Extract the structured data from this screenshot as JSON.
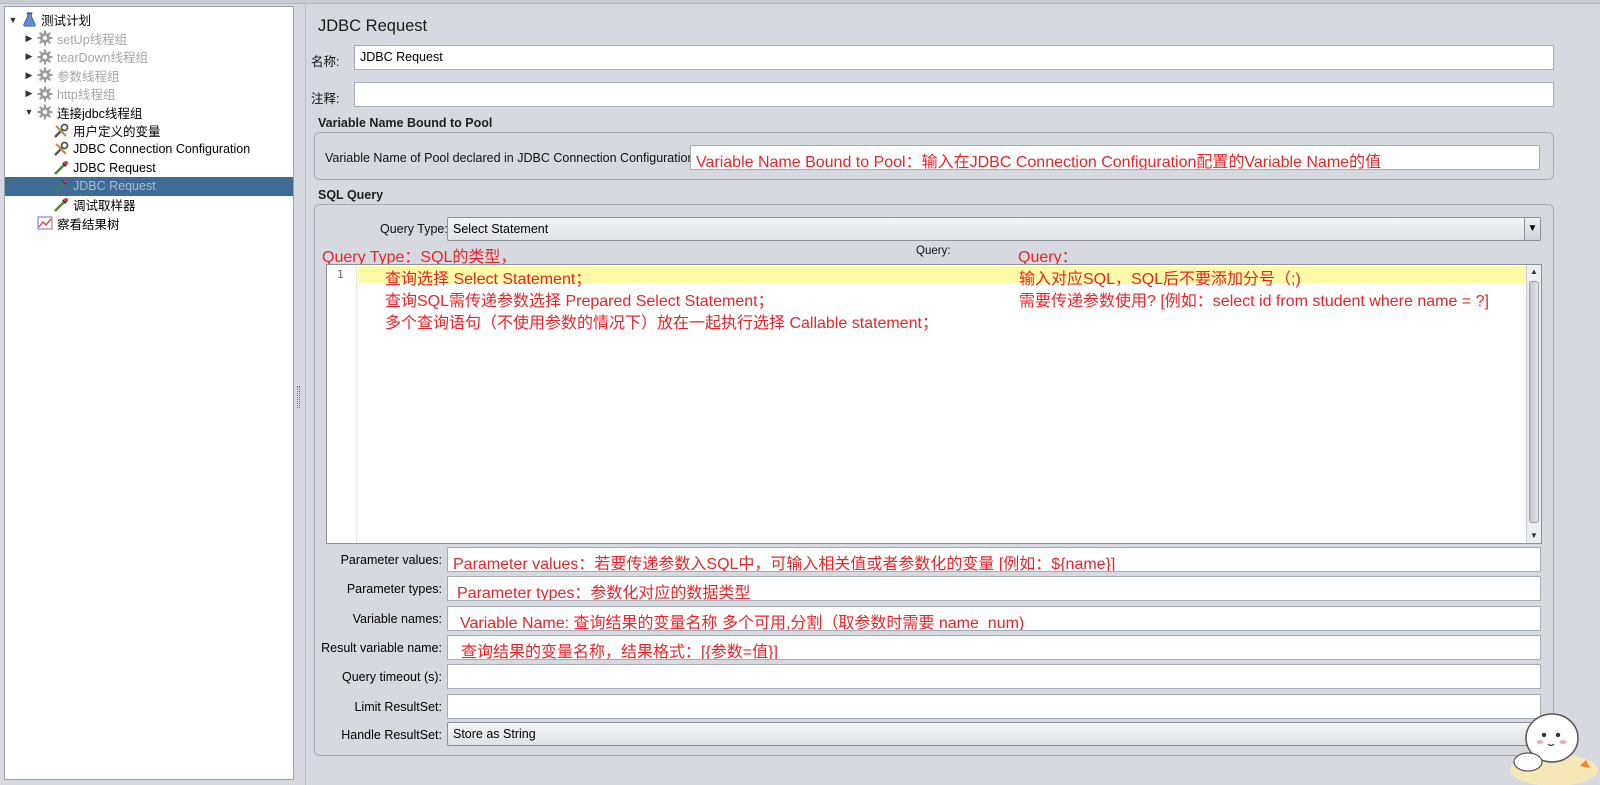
{
  "tree": {
    "items": [
      {
        "label": "测试计划",
        "toggle": "▼",
        "icon": "flask-icon",
        "indent": 0,
        "state": "normal"
      },
      {
        "label": "setUp线程组",
        "toggle": "▶",
        "icon": "gear-icon",
        "indent": 1,
        "state": "disabled"
      },
      {
        "label": "tearDown线程组",
        "toggle": "▶",
        "icon": "gear-icon",
        "indent": 1,
        "state": "disabled"
      },
      {
        "label": "参数线程组",
        "toggle": "▶",
        "icon": "gear-icon",
        "indent": 1,
        "state": "disabled"
      },
      {
        "label": "http线程组",
        "toggle": "▶",
        "icon": "gear-icon",
        "indent": 1,
        "state": "disabled"
      },
      {
        "label": "连接jdbc线程组",
        "toggle": "▼",
        "icon": "gear-icon",
        "indent": 1,
        "state": "normal"
      },
      {
        "label": "用户定义的变量",
        "toggle": "",
        "icon": "wrench-icon",
        "indent": 2,
        "state": "normal"
      },
      {
        "label": "JDBC Connection Configuration",
        "toggle": "",
        "icon": "wrench-icon",
        "indent": 2,
        "state": "normal"
      },
      {
        "label": "JDBC Request",
        "toggle": "",
        "icon": "pipette-icon",
        "indent": 2,
        "state": "normal"
      },
      {
        "label": "JDBC Request",
        "toggle": "",
        "icon": "pipette-icon",
        "indent": 2,
        "state": "selected"
      },
      {
        "label": "调试取样器",
        "toggle": "",
        "icon": "pipette-icon",
        "indent": 2,
        "state": "normal"
      },
      {
        "label": "察看结果树",
        "toggle": "",
        "icon": "chart-icon",
        "indent": 1,
        "state": "normal"
      }
    ]
  },
  "panel": {
    "title": "JDBC Request",
    "name_label": "名称:",
    "name_value": "JDBC Request",
    "comment_label": "注释:",
    "comment_value": "",
    "pool_group_title": "Variable Name Bound to Pool",
    "pool_label": "Variable Name of Pool declared in JDBC Connection Configuration:",
    "pool_value": "Variable Name Bound to Pool：输入在JDBC Connection Configuration配置的Variable Name的值",
    "sql_group_title": "SQL Query",
    "query_type_label": "Query Type:",
    "query_type_value": "Select Statement",
    "query_label": "Query:",
    "annot_query_type": "Query Type：SQL的类型，",
    "annot_query": "Query：",
    "code_line_number": "1",
    "code_lines_left": [
      "查询选择  Select Statement；",
      "查询SQL需传递参数选择   Prepared Select Statement；",
      "多个查询语句（不使用参数的情况下）放在一起执行选择  Callable statement；"
    ],
    "code_lines_right": [
      "输入对应SQL，SQL后不要添加分号（;)",
      "需要传递参数使用? [例如：select id from student where name = ?]"
    ],
    "param_values_label": "Parameter values:",
    "param_values_value": "Parameter values：若要传递参数入SQL中，可输入相关值或者参数化的变量 [例如：${name}]",
    "param_types_label": "Parameter types:",
    "param_types_value": "Parameter types：参数化对应的数据类型",
    "var_names_label": "Variable names:",
    "var_names_value": "Variable Name: 查询结果的变量名称 多个可用,分割（取参数时需要 name_num)",
    "result_var_label": "Result variable name:",
    "result_var_value": "查询结果的变量名称，结果格式：[{参数=值}]",
    "timeout_label": "Query timeout (s):",
    "timeout_value": "",
    "limit_label": "Limit ResultSet:",
    "limit_value": "",
    "handle_label": "Handle ResultSet:",
    "handle_value": "Store as String"
  },
  "colors": {
    "annotation": "#e8262a",
    "selection": "#3f6b95",
    "highlight_line": "#fffaa8"
  }
}
